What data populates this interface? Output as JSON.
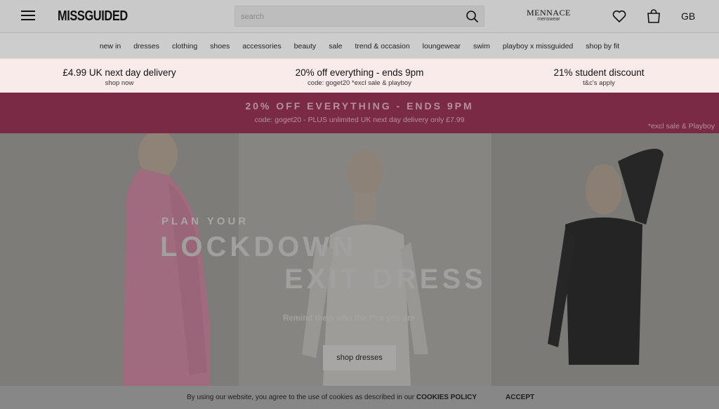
{
  "header": {
    "logo": "MISSGUIDED",
    "search_placeholder": "search",
    "mennace_brand": "MENNACE",
    "mennace_sub": "menswear",
    "region": "GB"
  },
  "nav": {
    "items": [
      "new in",
      "dresses",
      "clothing",
      "shoes",
      "accessories",
      "beauty",
      "sale",
      "trend & occasion",
      "loungewear",
      "swim",
      "playboy x missguided",
      "shop by fit"
    ]
  },
  "promo": {
    "items": [
      {
        "title": "£4.99 UK next day delivery",
        "sub": "shop now"
      },
      {
        "title": "20% off everything - ends 9pm",
        "sub": "code: goget20 *excl sale & playboy"
      },
      {
        "title": "21% student discount",
        "sub": "t&c's apply"
      }
    ]
  },
  "banner": {
    "headline": "20% OFF EVERYTHING - ENDS 9PM",
    "code": "code: goget20 - PLUS unlimited UK next day delivery only £7.99",
    "note": "*excl sale & Playboy"
  },
  "hero": {
    "kicker": "PLAN YOUR",
    "line1": "LOCKDOWN",
    "line2": "EXIT DRESS",
    "sub": "Remind them who the f*ck you are",
    "cta": "shop dresses"
  },
  "cookie": {
    "text": "By using our website, you agree to the use of cookies as described in our",
    "policy": "COOKIES POLICY",
    "accept": "ACCEPT"
  },
  "colors": {
    "banner": "#7a2a44",
    "promo_bg": "#f8ebea",
    "overlay": "#7d7d7d"
  }
}
